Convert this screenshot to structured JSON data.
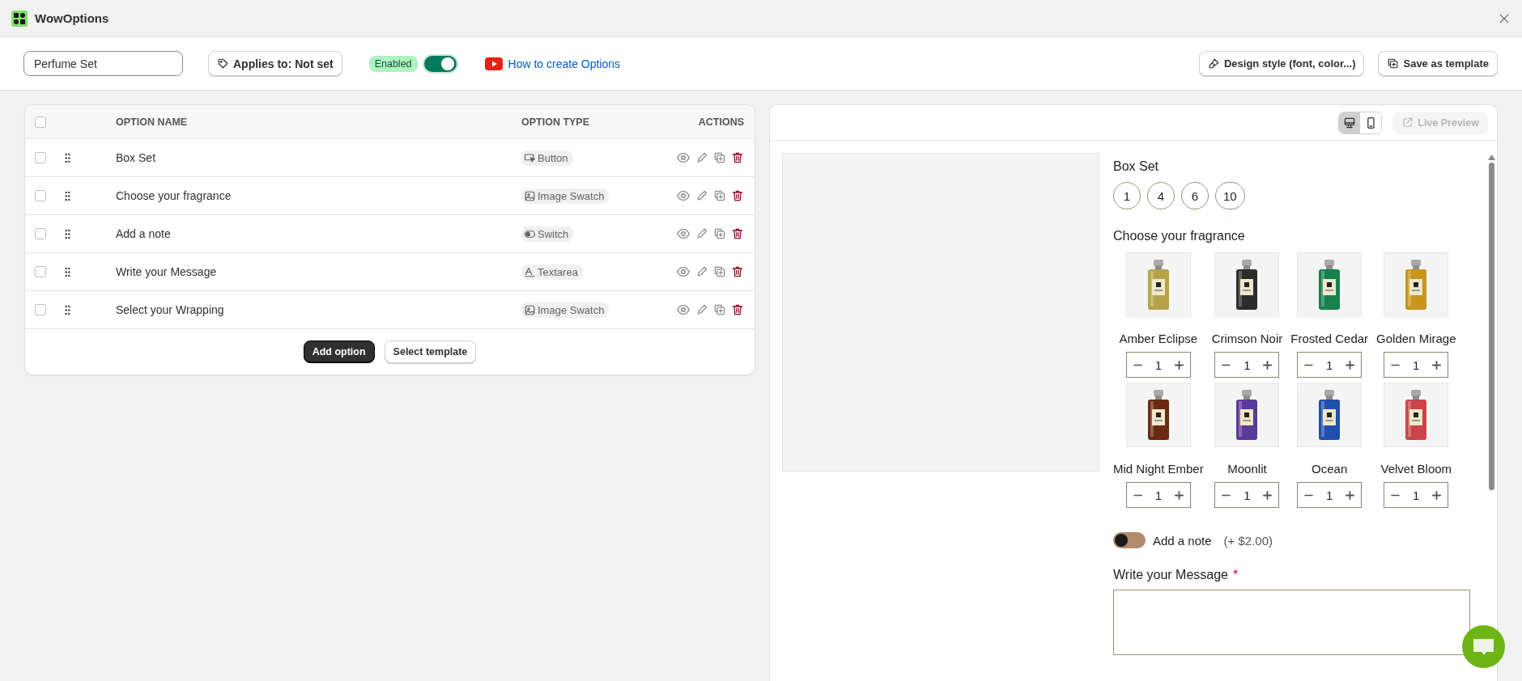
{
  "app": {
    "title": "WowOptions"
  },
  "toolbar": {
    "option_set_name": "Perfume Set",
    "applies_to": "Applies to: Not set",
    "status_badge": "Enabled",
    "enabled": true,
    "help_link": "How to create Options",
    "design_button": "Design style (font, color...)",
    "template_button": "Save as template"
  },
  "options_table": {
    "select_all_checked": false,
    "columns": [
      "OPTION NAME",
      "OPTION TYPE",
      "ACTIONS"
    ],
    "rows": [
      {
        "name": "Box Set",
        "type": "Button",
        "kind": "button",
        "checked": false
      },
      {
        "name": "Choose your fragrance",
        "type": "Image Swatch",
        "kind": "swatch",
        "checked": false
      },
      {
        "name": "Add a note",
        "type": "Switch",
        "kind": "switch",
        "checked": false
      },
      {
        "name": "Write your Message",
        "type": "Textarea",
        "kind": "textarea",
        "checked": false
      },
      {
        "name": "Select your Wrapping",
        "type": "Image Swatch",
        "kind": "swatch",
        "checked": false
      }
    ],
    "buttons": [
      "Add option",
      "Select template"
    ]
  },
  "preview": {
    "devices": [
      {
        "kind": "desktop",
        "selected": true
      },
      {
        "kind": "mobile",
        "selected": false
      }
    ],
    "live_preview": "Live Preview",
    "live_preview_disabled": true,
    "box_set": {
      "label": "Box Set",
      "values": [
        {
          "label": "1",
          "selected": false
        },
        {
          "label": "4",
          "selected": false
        },
        {
          "label": "6",
          "selected": false
        },
        {
          "label": "10",
          "selected": false
        }
      ]
    },
    "fragrance": {
      "label": "Choose your fragrance",
      "swatches": [
        {
          "name": "Amber Eclipse",
          "quantity": "1"
        },
        {
          "name": "Crimson Noir",
          "quantity": "1"
        },
        {
          "name": "Frosted Cedar",
          "quantity": "1"
        },
        {
          "name": "Golden Mirage",
          "quantity": "1"
        },
        {
          "name": "Mid Night Ember",
          "quantity": "1"
        },
        {
          "name": "Moonlit",
          "quantity": "1"
        },
        {
          "name": "Ocean",
          "quantity": "1"
        },
        {
          "name": "Velvet Bloom",
          "quantity": "1"
        }
      ]
    },
    "note": {
      "label": "Add a note",
      "price": "(+ $2.00)",
      "on": false
    },
    "message": {
      "label": "Write your Message",
      "required": true,
      "required_mark": "*"
    }
  }
}
